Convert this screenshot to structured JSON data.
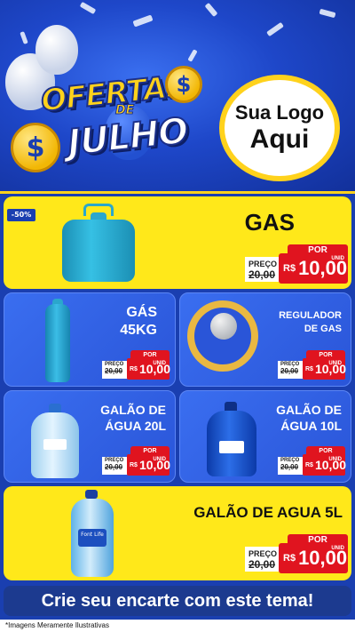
{
  "header": {
    "title_line1": "OFERTAS",
    "title_de": "DE",
    "title_line2": "JULHO",
    "coin_symbol": "$",
    "logo_line1": "Sua Logo",
    "logo_line2": "Aqui"
  },
  "colors": {
    "brand_blue": "#1a3fb0",
    "card_yellow": "#ffe81a",
    "price_red": "#e0141f",
    "accent_gold": "#ffd21c"
  },
  "products": [
    {
      "id": "gas",
      "name": "GAS",
      "discount_badge": "-50%",
      "por_label": "POR",
      "preco_label": "PREÇO",
      "old_price": "20,00",
      "currency": "R$",
      "new_price": "10,00",
      "unit": "UNID"
    },
    {
      "id": "gas-45kg",
      "name_line1": "GÁS",
      "name_line2": "45KG",
      "por_label": "POR",
      "preco_label": "PREÇO",
      "old_price": "20,00",
      "currency": "R$",
      "new_price": "10,00",
      "unit": "UNID"
    },
    {
      "id": "regulador",
      "name_line1": "REGULADOR",
      "name_line2": "DE GAS",
      "por_label": "POR",
      "preco_label": "PREÇO",
      "old_price": "20,00",
      "currency": "R$",
      "new_price": "10,00",
      "unit": "UNID"
    },
    {
      "id": "galao-20l",
      "name_line1": "GALÃO DE",
      "name_line2": "ÁGUA 20L",
      "por_label": "POR",
      "preco_label": "PREÇO",
      "old_price": "20,00",
      "currency": "R$",
      "new_price": "10,00",
      "unit": "UNID"
    },
    {
      "id": "galao-10l",
      "name_line1": "GALÃO DE",
      "name_line2": "ÁGUA 10L",
      "por_label": "POR",
      "preco_label": "PREÇO",
      "old_price": "20,00",
      "currency": "R$",
      "new_price": "10,00",
      "unit": "UNID"
    },
    {
      "id": "galao-5l",
      "name": "GALÃO DE AGUA 5L",
      "bottle_label": "Font Life",
      "por_label": "POR",
      "preco_label": "PREÇO",
      "old_price": "20,00",
      "currency": "R$",
      "new_price": "10,00",
      "unit": "UNID"
    }
  ],
  "cta": {
    "label": "Crie seu encarte com este tema!"
  },
  "footer": {
    "disclaimer": "*Imagens Meramente Ilustrativas"
  }
}
